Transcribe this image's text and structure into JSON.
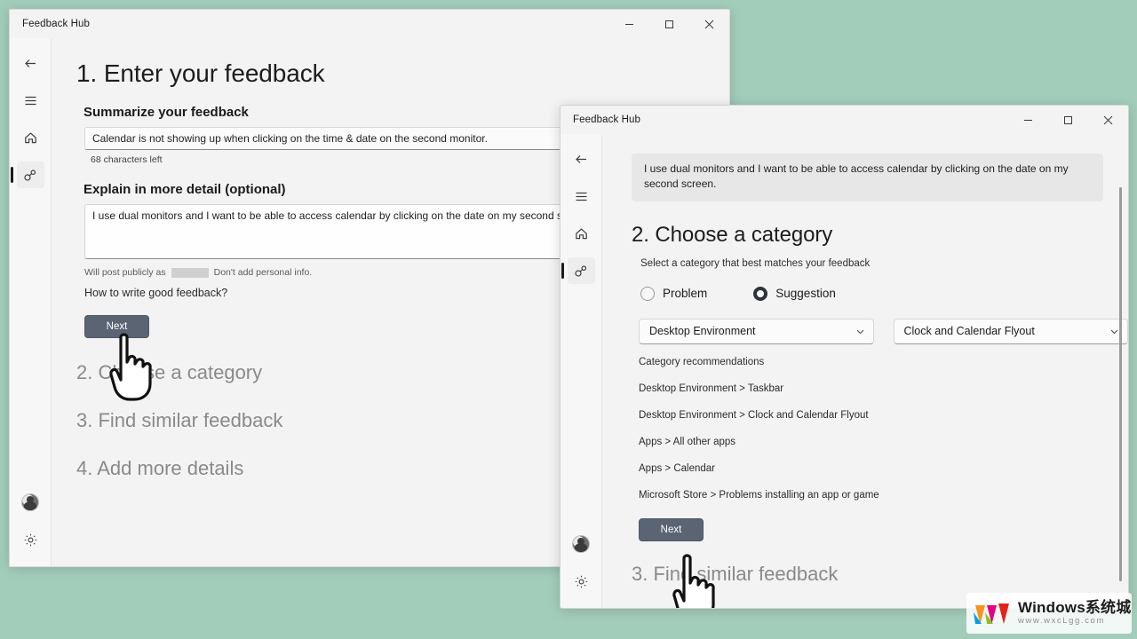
{
  "desktop": {
    "background_color": "#a3cdbb"
  },
  "window_back": {
    "title": "Feedback Hub",
    "caption": {
      "minimize": "minimize",
      "maximize": "maximize",
      "close": "close"
    },
    "rail": [
      {
        "icon": "back-arrow-icon",
        "selected": false
      },
      {
        "icon": "hamburger-menu-icon",
        "selected": false
      },
      {
        "icon": "home-icon",
        "selected": false
      },
      {
        "icon": "feedback-icon",
        "selected": true
      }
    ],
    "rail_bottom": [
      {
        "icon": "account-avatar-icon"
      },
      {
        "icon": "settings-gear-icon"
      }
    ],
    "step1_title": "1. Enter your feedback",
    "summarize_label": "Summarize your feedback",
    "summarize_value": "Calendar is not showing up when clicking on the time & date on the second monitor.",
    "characters_left": "68 characters left",
    "detail_label": "Explain in more detail (optional)",
    "detail_value": "I use dual monitors and I want to be able to access calendar by clicking on the date on my second sc",
    "privacy_prefix": "Will post publicly as",
    "privacy_suffix": "Don't add personal info.",
    "help_link": "How to write good feedback?",
    "next_label": "Next",
    "step2_title": "2. Choose a category",
    "step3_title": "3. Find similar feedback",
    "step4_title": "4. Add more details"
  },
  "window_front": {
    "title": "Feedback Hub",
    "caption": {
      "minimize": "minimize",
      "maximize": "maximize",
      "close": "close"
    },
    "rail": [
      {
        "icon": "back-arrow-icon",
        "selected": false
      },
      {
        "icon": "hamburger-menu-icon",
        "selected": false
      },
      {
        "icon": "home-icon",
        "selected": false
      },
      {
        "icon": "feedback-icon",
        "selected": true
      }
    ],
    "rail_bottom": [
      {
        "icon": "account-avatar-icon"
      },
      {
        "icon": "settings-gear-icon"
      }
    ],
    "quote_text": "I use dual monitors and I want to be able to access calendar by clicking on the date on my second screen.",
    "step2_title": "2. Choose a category",
    "step2_subtitle": "Select a category that best matches your feedback",
    "radios": [
      {
        "label": "Problem",
        "checked": false
      },
      {
        "label": "Suggestion",
        "checked": true
      }
    ],
    "category_dropdown": {
      "value": "Desktop Environment",
      "chevron": "chevron-down-icon"
    },
    "subcategory_dropdown": {
      "value": "Clock and Calendar Flyout",
      "chevron": "chevron-down-icon"
    },
    "recommendations_title": "Category recommendations",
    "recommendations": [
      "Desktop Environment > Taskbar",
      "Desktop Environment > Clock and Calendar Flyout",
      "Apps > All other apps",
      "Apps > Calendar",
      "Microsoft Store > Problems installing an app or game"
    ],
    "next_label": "Next",
    "step3_title": "3. Find similar feedback"
  },
  "watermark": {
    "title": "Windows系统城",
    "url": "www.wxcLgg.com"
  }
}
